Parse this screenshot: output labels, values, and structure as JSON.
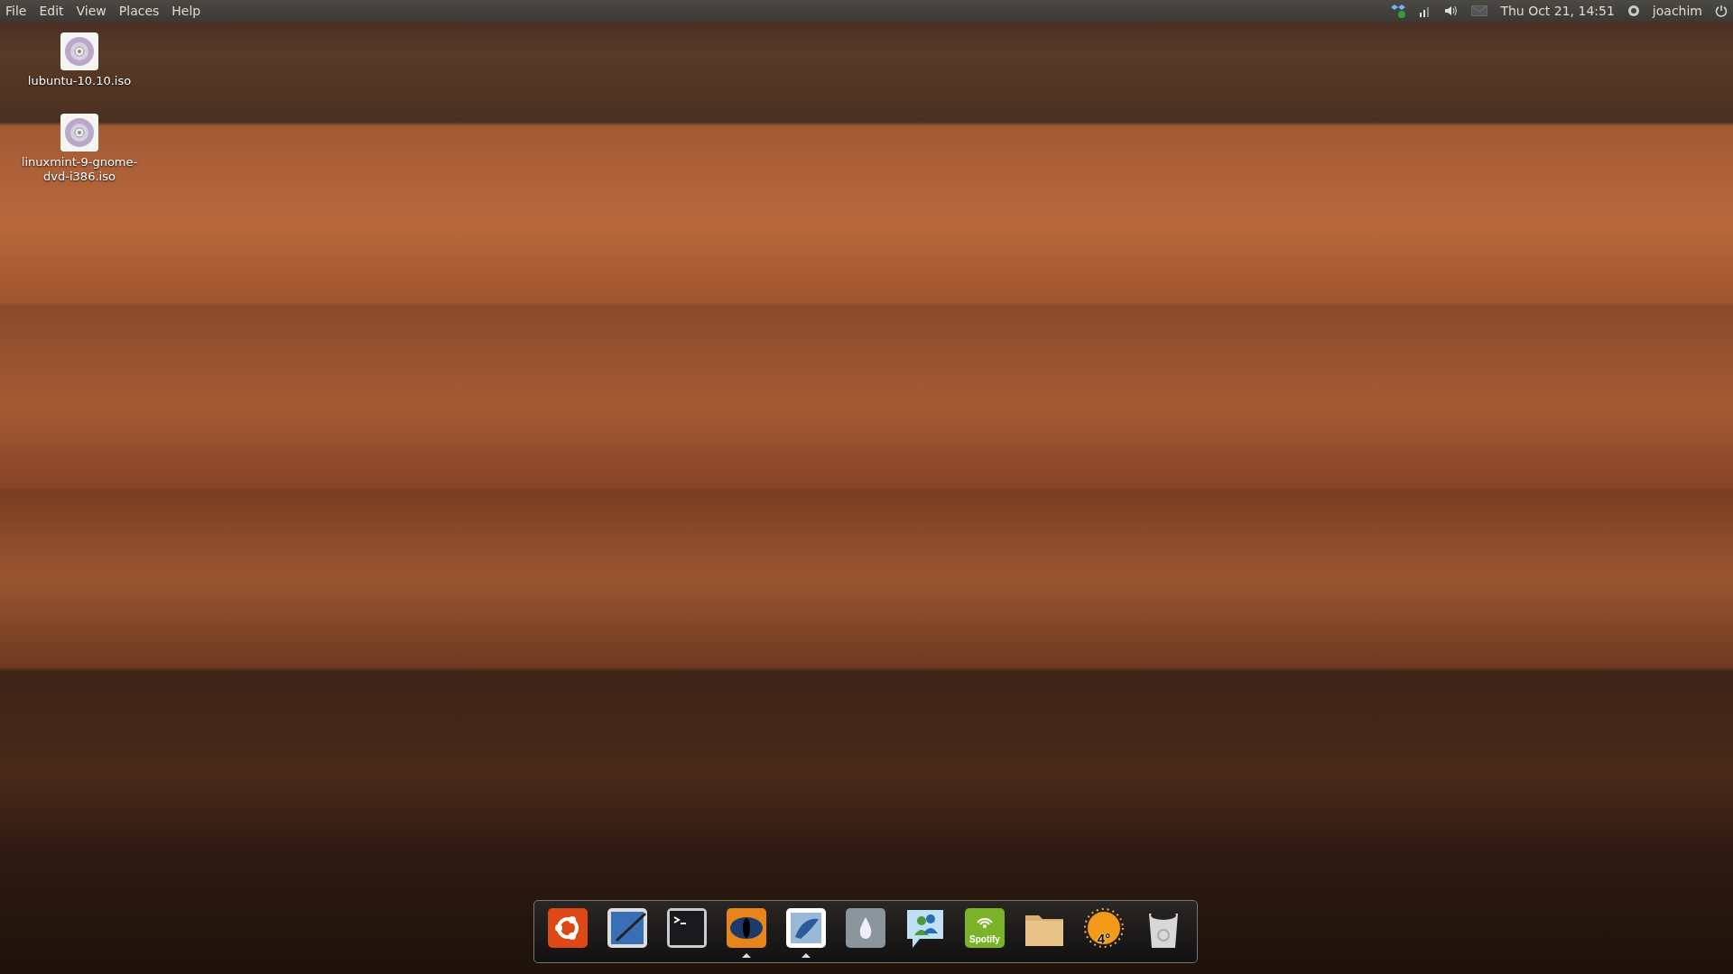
{
  "menu_bar": {
    "items": [
      "File",
      "Edit",
      "View",
      "Places",
      "Help"
    ]
  },
  "panel": {
    "clock": "Thu Oct 21, 14:51",
    "user": "joachim"
  },
  "desktop_icons": [
    {
      "label": "lubuntu-10.10.iso"
    },
    {
      "label": "linuxmint-9-gnome-dvd-i386.iso"
    }
  ],
  "dock": {
    "items": [
      {
        "kind": "ubuntu",
        "running": false
      },
      {
        "kind": "desktop",
        "running": false
      },
      {
        "kind": "terminal",
        "running": false
      },
      {
        "kind": "eye",
        "running": true
      },
      {
        "kind": "stamp",
        "running": true
      },
      {
        "kind": "drop",
        "running": false
      },
      {
        "kind": "chat",
        "running": false
      },
      {
        "kind": "spotify",
        "label": "Spotify",
        "running": false
      },
      {
        "kind": "folder",
        "running": false
      },
      {
        "kind": "weather",
        "label": "4°",
        "running": false
      },
      {
        "kind": "trash",
        "running": false
      }
    ]
  }
}
